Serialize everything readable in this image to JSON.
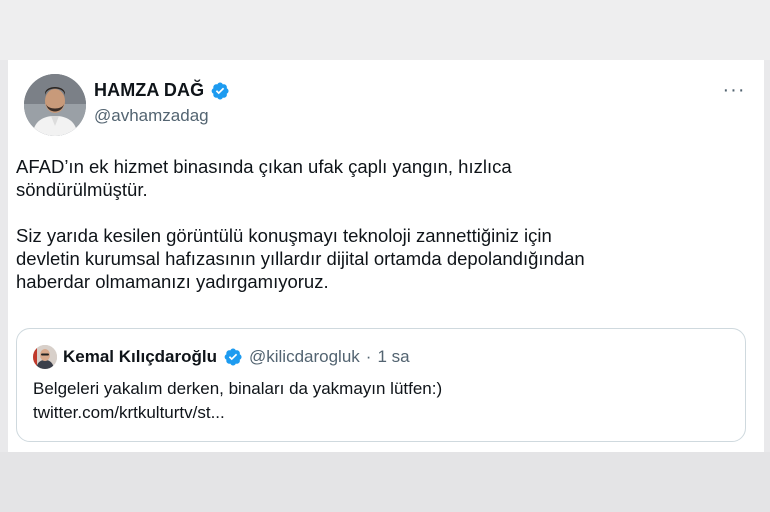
{
  "tweet": {
    "display_name": "HAMZA DAĞ",
    "handle": "@avhamzadag",
    "more_label": "···",
    "paragraph1": "AFAD’ın ek hizmet binasında çıkan ufak çaplı yangın, hızlıca\nsöndürülmüştür.",
    "paragraph2": "Siz yarıda kesilen görüntülü konuşmayı teknoloji zannettiğiniz için\ndevletin kurumsal hafızasının yıllardır dijital ortamda depolandığından\nhaberdar olmamanızı yadırgamıyoruz."
  },
  "quote": {
    "display_name": "Kemal Kılıçdaroğlu",
    "handle": "@kilicdarogluk",
    "separator": "·",
    "time": "1 sa",
    "line1": "Belgeleri yakalım derken, binaları da yakmayın lütfen:)",
    "line2": "twitter.com/krtkulturtv/st..."
  },
  "colors": {
    "verified": "#1d9bf0",
    "text": "#0f1419",
    "secondary": "#536471",
    "border": "#cfd9de"
  },
  "icons": {
    "verified": "verified-badge-icon",
    "more": "more-options-icon"
  }
}
